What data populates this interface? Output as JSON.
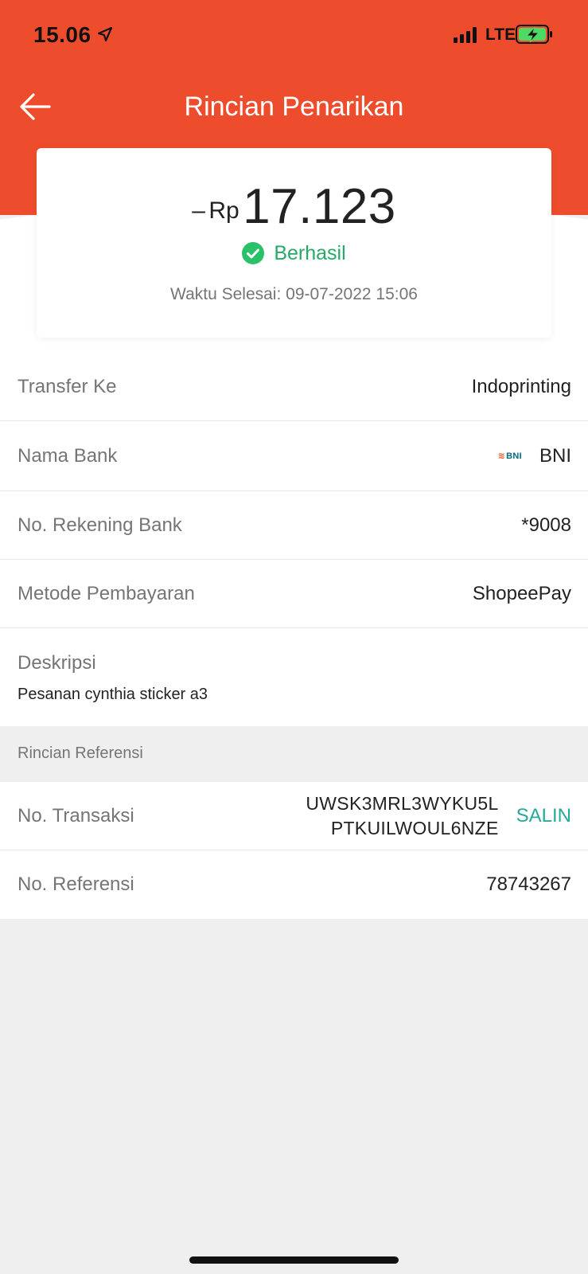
{
  "status_bar": {
    "time": "15.06",
    "network": "LTE"
  },
  "header": {
    "title": "Rincian Penarikan"
  },
  "summary": {
    "sign": "–",
    "currency": "Rp",
    "amount": "17.123",
    "status": "Berhasil",
    "completed_time": "Waktu Selesai: 09-07-2022 15:06"
  },
  "details": {
    "transfer_to_label": "Transfer Ke",
    "transfer_to_value": "Indoprinting",
    "bank_name_label": "Nama Bank",
    "bank_logo_text": "BNI",
    "bank_name_value": "BNI",
    "account_no_label": "No. Rekening Bank",
    "account_no_value": "*9008",
    "payment_method_label": "Metode Pembayaran",
    "payment_method_value": "ShopeePay",
    "description_label": "Deskripsi",
    "description_value": "Pesanan cynthia sticker a3"
  },
  "reference": {
    "section_title": "Rincian Referensi",
    "transaction_no_label": "No. Transaksi",
    "transaction_no_line1": "UWSK3MRL3WYKU5L",
    "transaction_no_line2": "PTKUILWOUL6NZE",
    "copy_label": "SALIN",
    "reference_no_label": "No. Referensi",
    "reference_no_value": "78743267"
  },
  "colors": {
    "brand": "#ee4d2d",
    "success": "#26aa66",
    "copy_link": "#26aa99"
  }
}
